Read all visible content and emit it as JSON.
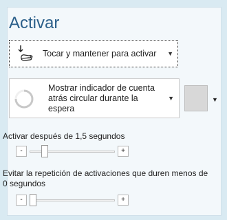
{
  "title": "Activar",
  "activation": {
    "selected": "Tocar y mantener para activar",
    "icon": "hand-tap-icon"
  },
  "indicator": {
    "selected": "Mostrar indicador de cuenta atrás circular durante la espera",
    "icon": "circular-countdown-icon",
    "color_swatch": "#d8d8d8"
  },
  "activate_after": {
    "label": "Activar después de 1,5 segundos",
    "minus": "-",
    "plus": "+",
    "value": 1.5
  },
  "avoid_repeat": {
    "label": "Evitar la repetición de activaciones que duren menos de 0 segundos",
    "minus": "-",
    "plus": "+",
    "value": 0
  }
}
